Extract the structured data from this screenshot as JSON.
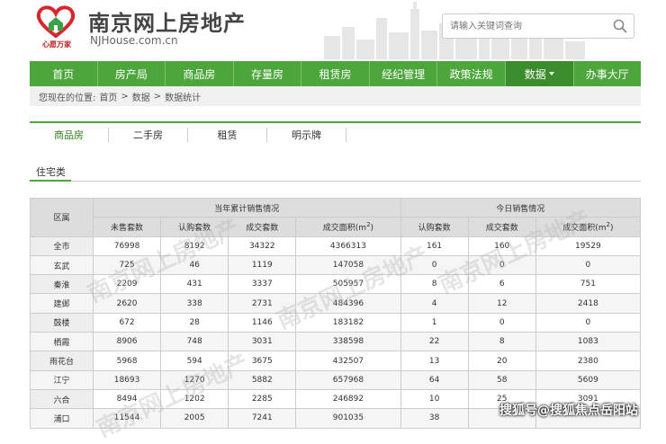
{
  "header": {
    "logo_text": "心愿万家",
    "site_title": "南京网上房地产",
    "site_domain": "NJHouse.com.cn"
  },
  "search": {
    "placeholder": "请输入关键词查询"
  },
  "nav": {
    "items": [
      {
        "label": "首页"
      },
      {
        "label": "房产局"
      },
      {
        "label": "商品房"
      },
      {
        "label": "存量房"
      },
      {
        "label": "租赁房"
      },
      {
        "label": "经纪管理"
      },
      {
        "label": "政策法规"
      },
      {
        "label": "数据"
      },
      {
        "label": "办事大厅"
      }
    ]
  },
  "breadcrumb": {
    "prefix": "您现在的位置:",
    "items": [
      "首页",
      ">",
      "数据",
      ">",
      "数据统计"
    ]
  },
  "subtabs": [
    {
      "label": "商品房"
    },
    {
      "label": "二手房"
    },
    {
      "label": "租赁"
    },
    {
      "label": "明示牌"
    }
  ],
  "section": {
    "title": "住宅类"
  },
  "table": {
    "area_header": "区属",
    "group1": "当年累计销售情况",
    "group2": "今日销售情况",
    "cols1": [
      "未售套数",
      "认购套数",
      "成交套数",
      "成交面积(m",
      "2",
      ")"
    ],
    "cols2": [
      "认购套数",
      "成交套数",
      "成交面积(m",
      "2",
      ")"
    ],
    "rows": [
      {
        "area": "全市",
        "v": [
          "76998",
          "8192",
          "34322",
          "4366313",
          "161",
          "160",
          "19529"
        ]
      },
      {
        "area": "玄武",
        "v": [
          "725",
          "46",
          "1119",
          "147058",
          "0",
          "0",
          "0"
        ]
      },
      {
        "area": "秦淮",
        "v": [
          "2209",
          "431",
          "3337",
          "505957",
          "8",
          "6",
          "751"
        ]
      },
      {
        "area": "建邺",
        "v": [
          "2620",
          "338",
          "2731",
          "484396",
          "4",
          "12",
          "2418"
        ]
      },
      {
        "area": "鼓楼",
        "v": [
          "672",
          "28",
          "1146",
          "183182",
          "1",
          "0",
          "0"
        ]
      },
      {
        "area": "栖霞",
        "v": [
          "8906",
          "748",
          "3031",
          "338598",
          "22",
          "8",
          "1083"
        ]
      },
      {
        "area": "雨花台",
        "v": [
          "5968",
          "594",
          "3675",
          "432507",
          "13",
          "20",
          "2380"
        ]
      },
      {
        "area": "江宁",
        "v": [
          "18693",
          "1270",
          "5882",
          "657968",
          "64",
          "58",
          "5609"
        ]
      },
      {
        "area": "六合",
        "v": [
          "8494",
          "1202",
          "2285",
          "246892",
          "10",
          "25",
          "3091"
        ]
      },
      {
        "area": "浦口",
        "v": [
          "11544",
          "2005",
          "7241",
          "901035",
          "38",
          "",
          ""
        ]
      }
    ]
  },
  "overlay": {
    "watermark_text": "搜狐号@搜狐焦点岳阳站",
    "wm_text": "南京网上房地产"
  },
  "colors": {
    "nav_green": "#4da63b",
    "nav_dark": "#3b8d2c",
    "logo_red": "#d9262c"
  }
}
